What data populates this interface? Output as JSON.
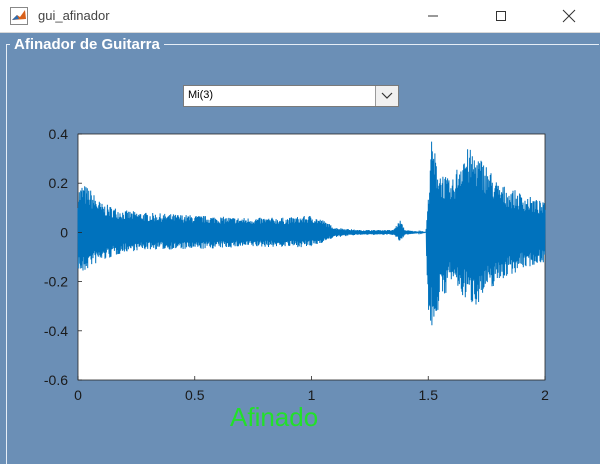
{
  "window": {
    "title": "gui_afinador",
    "controls": {
      "minimize_icon": "minimize-icon",
      "maximize_icon": "maximize-icon",
      "close_icon": "close-icon"
    }
  },
  "panel": {
    "title": "Afinador de Guitarra"
  },
  "string_select": {
    "selected": "Mi(3)"
  },
  "status": {
    "text": "Afinado",
    "color": "#22e02a"
  },
  "colors": {
    "background": "#6b8fb6",
    "signal": "#0072bd"
  },
  "chart_data": {
    "type": "line",
    "title": "",
    "xlabel": "",
    "ylabel": "",
    "xlim": [
      0,
      2
    ],
    "ylim": [
      -0.6,
      0.4
    ],
    "xticks": [
      "0",
      "0.5",
      "1",
      "1.5",
      "2"
    ],
    "yticks": [
      "-0.6",
      "-0.4",
      "-0.2",
      "0",
      "0.2",
      "0.4"
    ],
    "grid": false,
    "series": [
      {
        "envelope_upper": [
          [
            0,
            0.18
          ],
          [
            0.02,
            0.2
          ],
          [
            0.05,
            0.18
          ],
          [
            0.1,
            0.12
          ],
          [
            0.2,
            0.09
          ],
          [
            0.3,
            0.08
          ],
          [
            0.5,
            0.07
          ],
          [
            0.7,
            0.06
          ],
          [
            0.9,
            0.06
          ],
          [
            1.0,
            0.07
          ],
          [
            1.05,
            0.05
          ],
          [
            1.1,
            0.02
          ],
          [
            1.2,
            0.01
          ],
          [
            1.35,
            0.01
          ],
          [
            1.38,
            0.05
          ],
          [
            1.4,
            0.01
          ],
          [
            1.49,
            0.0
          ],
          [
            1.5,
            0.14
          ],
          [
            1.51,
            0.39
          ],
          [
            1.55,
            0.26
          ],
          [
            1.6,
            0.2
          ],
          [
            1.65,
            0.35
          ],
          [
            1.7,
            0.33
          ],
          [
            1.75,
            0.28
          ],
          [
            1.8,
            0.2
          ],
          [
            1.9,
            0.16
          ],
          [
            2.0,
            0.12
          ]
        ],
        "envelope_lower": [
          [
            0,
            -0.15
          ],
          [
            0.02,
            -0.18
          ],
          [
            0.05,
            -0.14
          ],
          [
            0.1,
            -0.12
          ],
          [
            0.2,
            -0.08
          ],
          [
            0.3,
            -0.07
          ],
          [
            0.5,
            -0.07
          ],
          [
            0.7,
            -0.06
          ],
          [
            0.9,
            -0.06
          ],
          [
            1.0,
            -0.06
          ],
          [
            1.05,
            -0.04
          ],
          [
            1.1,
            -0.02
          ],
          [
            1.2,
            -0.01
          ],
          [
            1.35,
            -0.01
          ],
          [
            1.38,
            -0.04
          ],
          [
            1.4,
            -0.01
          ],
          [
            1.49,
            0.0
          ],
          [
            1.5,
            -0.35
          ],
          [
            1.51,
            -0.41
          ],
          [
            1.55,
            -0.3
          ],
          [
            1.6,
            -0.2
          ],
          [
            1.65,
            -0.27
          ],
          [
            1.7,
            -0.3
          ],
          [
            1.75,
            -0.25
          ],
          [
            1.8,
            -0.2
          ],
          [
            1.9,
            -0.15
          ],
          [
            2.0,
            -0.12
          ]
        ]
      }
    ]
  }
}
